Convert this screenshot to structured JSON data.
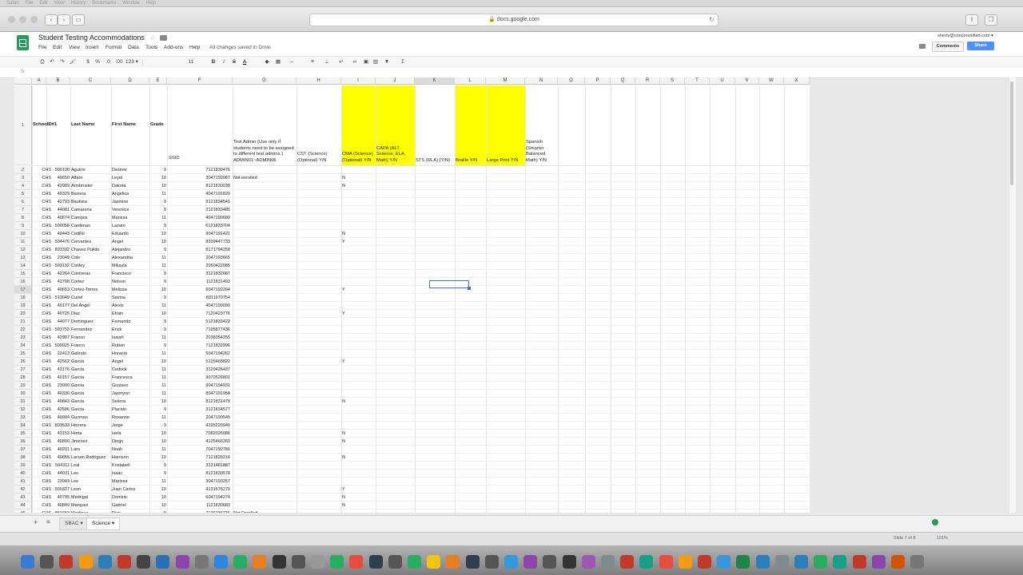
{
  "browser": {
    "url": "docs.google.com"
  },
  "doc": {
    "title": "Student Testing Accommodations",
    "save_status": "All changes saved in Drive"
  },
  "menus": [
    "File",
    "Edit",
    "View",
    "Insert",
    "Format",
    "Data",
    "Tools",
    "Add-ons",
    "Help"
  ],
  "account": {
    "email": "sherry@concorunified.com ▾",
    "comments_label": "Comments",
    "share_label": "Share"
  },
  "toolbar": {
    "zoom": "123 ▾",
    "font_size": "11",
    "currency": "$",
    "percent": "%",
    "dec_less": ".0",
    "dec_more": ".00",
    "bold": "B",
    "italic": "I",
    "strike": "S"
  },
  "formula_bar": {
    "label": "fx",
    "value": ""
  },
  "columns": [
    "A",
    "B",
    "C",
    "D",
    "E",
    "F",
    "G",
    "H",
    "I",
    "J",
    "K",
    "L",
    "M",
    "N",
    "O",
    "P",
    "Q",
    "R",
    "S",
    "T",
    "U",
    "V",
    "W",
    "X"
  ],
  "selected_column": "K",
  "header_row": {
    "row_number": "1",
    "School": "School",
    "ID": "ID#1",
    "Last": "Last Name",
    "First": "First Name",
    "Grade": "Grade",
    "SSID": "SSID",
    "G": "Test Admin (Use only if students need to be assigned to different test admins.) ADMIN01~ADMIN06",
    "H": "CST (Science) (Optional) Y/N",
    "I": "CMA (Science) (Optional) Y/N",
    "J": "CAPA (ALT-Science, ELA, Math) Y/N",
    "K": "STS (RLA) (Y/N)",
    "L": "Braille Y/N",
    "M": "Large Print Y/N",
    "N": "Spanish (Smarter Balanced Math) Y/N"
  },
  "highlight_color": "#ffff00",
  "rows": [
    {
      "n": "2",
      "school": "CHS",
      "id": "500190",
      "last": "Aguirre",
      "first": "Desiree",
      "grade": "9",
      "ssid": "7121830476",
      "g": "",
      "i": ""
    },
    {
      "n": "3",
      "school": "CHS",
      "id": "40650",
      "last": "Alfaro",
      "first": "Leyol",
      "grade": "10",
      "ssid": "3047192087",
      "g": "Not enrolled",
      "i": "N"
    },
    {
      "n": "4",
      "school": "CHS",
      "id": "42989",
      "last": "Armbruster",
      "first": "Dakota",
      "grade": "10",
      "ssid": "8121830038",
      "g": "",
      "i": "N"
    },
    {
      "n": "5",
      "school": "CHS",
      "id": "40329",
      "last": "Barrera",
      "first": "Angelica",
      "grade": "11",
      "ssid": "4047191820",
      "g": "",
      "i": ""
    },
    {
      "n": "6",
      "school": "CHS",
      "id": "42793",
      "last": "Bautista",
      "first": "Jasmine",
      "grade": "9",
      "ssid": "9121834541",
      "g": "",
      "i": ""
    },
    {
      "n": "7",
      "school": "CHS",
      "id": "44081",
      "last": "Camarena",
      "first": "Verenice",
      "grade": "9",
      "ssid": "2121833485",
      "g": "",
      "i": ""
    },
    {
      "n": "8",
      "school": "CHS",
      "id": "40674",
      "last": "Campos",
      "first": "Marissa",
      "grade": "11",
      "ssid": "4047190680",
      "g": "",
      "i": ""
    },
    {
      "n": "9",
      "school": "CHS",
      "id": "500058",
      "last": "Cardenas",
      "first": "Lazaro",
      "grade": "9",
      "ssid": "6121833704",
      "g": "",
      "i": ""
    },
    {
      "n": "10",
      "school": "CHS",
      "id": "40443",
      "last": "Cedillo",
      "first": "Eduardo",
      "grade": "10",
      "ssid": "9047191421",
      "g": "",
      "i": "N"
    },
    {
      "n": "11",
      "school": "CHS",
      "id": "504476",
      "last": "Cervantes",
      "first": "Angel",
      "grade": "10",
      "ssid": "8339447733",
      "g": "",
      "i": "Y"
    },
    {
      "n": "12",
      "school": "CHS",
      "id": "893332",
      "last": "Chavez Pulido",
      "first": "Alejandro",
      "grade": "9",
      "ssid": "8171794258",
      "g": "",
      "i": ""
    },
    {
      "n": "13",
      "school": "CHS",
      "id": "23049",
      "last": "Cole",
      "first": "Alexandria",
      "grade": "11",
      "ssid": "2047193665",
      "g": "",
      "i": ""
    },
    {
      "n": "14",
      "school": "CHS",
      "id": "503132",
      "last": "Conley",
      "first": "Mikayla",
      "grade": "11",
      "ssid": "2050422085",
      "g": "",
      "i": ""
    },
    {
      "n": "15",
      "school": "CHS",
      "id": "42264",
      "last": "Contreras",
      "first": "Francisco",
      "grade": "9",
      "ssid": "3121832687",
      "g": "",
      "i": ""
    },
    {
      "n": "16",
      "school": "CHS",
      "id": "42798",
      "last": "Cortez",
      "first": "Nelson",
      "grade": "9",
      "ssid": "1121831493",
      "g": "",
      "i": ""
    },
    {
      "n": "17",
      "school": "CHS",
      "id": "40653",
      "last": "Cortez-Torres",
      "first": "Melissa",
      "grade": "10",
      "ssid": "6047192204",
      "g": "",
      "i": "Y"
    },
    {
      "n": "18",
      "school": "CHS",
      "id": "513049",
      "last": "Curiel",
      "first": "Savina",
      "grade": "9",
      "ssid": "8311670754",
      "g": "",
      "i": ""
    },
    {
      "n": "19",
      "school": "CHS",
      "id": "40177",
      "last": "Del Angel",
      "first": "Alexis",
      "grade": "11",
      "ssid": "4047190090",
      "g": "",
      "i": ""
    },
    {
      "n": "20",
      "school": "CHS",
      "id": "40725",
      "last": "Diaz",
      "first": "Efrain",
      "grade": "10",
      "ssid": "7120423776",
      "g": "",
      "i": "Y"
    },
    {
      "n": "21",
      "school": "CHS",
      "id": "44077",
      "last": "Dominguez",
      "first": "Fernando",
      "grade": "9",
      "ssid": "5121833422",
      "g": "",
      "i": ""
    },
    {
      "n": "22",
      "school": "CHS",
      "id": "503753",
      "last": "Fernandez",
      "first": "Erick",
      "grade": "9",
      "ssid": "7195877436",
      "g": "",
      "i": ""
    },
    {
      "n": "23",
      "school": "CHS",
      "id": "42907",
      "last": "Franco",
      "first": "Isaiah",
      "grade": "11",
      "ssid": "2038354255",
      "g": "",
      "i": ""
    },
    {
      "n": "24",
      "school": "CHS",
      "id": "500025",
      "last": "Franco",
      "first": "Ruben",
      "grade": "9",
      "ssid": "7121832996",
      "g": "",
      "i": ""
    },
    {
      "n": "25",
      "school": "CHS",
      "id": "22413",
      "last": "Galindo",
      "first": "Horacio",
      "grade": "11",
      "ssid": "5047194262",
      "g": "",
      "i": ""
    },
    {
      "n": "26",
      "school": "CHS",
      "id": "42562",
      "last": "Garcia",
      "first": "Angel",
      "grade": "10",
      "ssid": "5125465822",
      "g": "",
      "i": "Y"
    },
    {
      "n": "27",
      "school": "CHS",
      "id": "43176",
      "last": "Garcia",
      "first": "Cedrick",
      "grade": "11",
      "ssid": "3120426437",
      "g": "",
      "i": ""
    },
    {
      "n": "28",
      "school": "CHS",
      "id": "40157",
      "last": "Garcia",
      "first": "Francesca",
      "grade": "11",
      "ssid": "9070526801",
      "g": "",
      "i": ""
    },
    {
      "n": "29",
      "school": "CHS",
      "id": "23000",
      "last": "Garcia",
      "first": "Gustavo",
      "grade": "11",
      "ssid": "9047194931",
      "g": "",
      "i": ""
    },
    {
      "n": "30",
      "school": "CHS",
      "id": "40336",
      "last": "Garcia",
      "first": "Jasmynn",
      "grade": "11",
      "ssid": "8047191958",
      "g": "",
      "i": ""
    },
    {
      "n": "31",
      "school": "CHS",
      "id": "40843",
      "last": "Garcia",
      "first": "Selena",
      "grade": "10",
      "ssid": "8121831478",
      "g": "",
      "i": "N"
    },
    {
      "n": "32",
      "school": "CHS",
      "id": "42586",
      "last": "Garcia",
      "first": "Placido",
      "grade": "9",
      "ssid": "3121834577",
      "g": "",
      "i": ""
    },
    {
      "n": "33",
      "school": "CHS",
      "id": "40904",
      "last": "Guzman",
      "first": "Roxanne",
      "grade": "11",
      "ssid": "2047190545",
      "g": "",
      "i": ""
    },
    {
      "n": "34",
      "school": "CHS",
      "id": "803533",
      "last": "Herrera",
      "first": "Jorge",
      "grade": "9",
      "ssid": "4195220940",
      "g": "",
      "i": ""
    },
    {
      "n": "35",
      "school": "CHS",
      "id": "43153",
      "last": "Horta",
      "first": "Isela",
      "grade": "10",
      "ssid": "7082026086",
      "g": "",
      "i": "N"
    },
    {
      "n": "36",
      "school": "CHS",
      "id": "40890",
      "last": "Jimenez",
      "first": "Diego",
      "grade": "10",
      "ssid": "4125466260",
      "g": "",
      "i": "N"
    },
    {
      "n": "37",
      "school": "CHS",
      "id": "40201",
      "last": "Lara",
      "first": "Noah",
      "grade": "11",
      "ssid": "7047192756",
      "g": "",
      "i": ""
    },
    {
      "n": "38",
      "school": "CHS",
      "id": "40855",
      "last": "Larson Rodriguez",
      "first": "Harrison",
      "grade": "10",
      "ssid": "7121829216",
      "g": "",
      "i": "N"
    },
    {
      "n": "39",
      "school": "CHS",
      "id": "504311",
      "last": "Leal",
      "first": "Kristabell",
      "grade": "9",
      "ssid": "3121481887",
      "g": "",
      "i": ""
    },
    {
      "n": "40",
      "school": "CHS",
      "id": "44031",
      "last": "Lee",
      "first": "Isaac",
      "grade": "9",
      "ssid": "8121830578",
      "g": "",
      "i": ""
    },
    {
      "n": "41",
      "school": "CHS",
      "id": "23043",
      "last": "Lee",
      "first": "Marissa",
      "grade": "11",
      "ssid": "3047193257",
      "g": "",
      "i": ""
    },
    {
      "n": "42",
      "school": "CHS",
      "id": "500327",
      "last": "Leon",
      "first": "Juan Carlos",
      "grade": "10",
      "ssid": "4131675270",
      "g": "",
      "i": "Y"
    },
    {
      "n": "43",
      "school": "CHS",
      "id": "40795",
      "last": "Medrigal",
      "first": "Dominic",
      "grade": "10",
      "ssid": "6047194274",
      "g": "",
      "i": "N"
    },
    {
      "n": "44",
      "school": "CHS",
      "id": "40849",
      "last": "Marquez",
      "first": "Gabriel",
      "grade": "10",
      "ssid": "1121830683",
      "g": "",
      "i": "N"
    },
    {
      "n": "45",
      "school": "CHS",
      "id": "851653",
      "last": "Martinez",
      "first": "Rico",
      "grade": "9",
      "ssid": "7136336736",
      "g": "Not Enrolled",
      "i": ""
    }
  ],
  "sheet_tabs": {
    "tab1": "SBAC ▾",
    "tab2": "Science ▾"
  },
  "status_bar": {
    "slide": "Slide 7 of 8",
    "zoom": "101%"
  },
  "mac_menu": [
    "Safari",
    "File",
    "Edit",
    "View",
    "History",
    "Bookmarks",
    "Window",
    "Help"
  ]
}
